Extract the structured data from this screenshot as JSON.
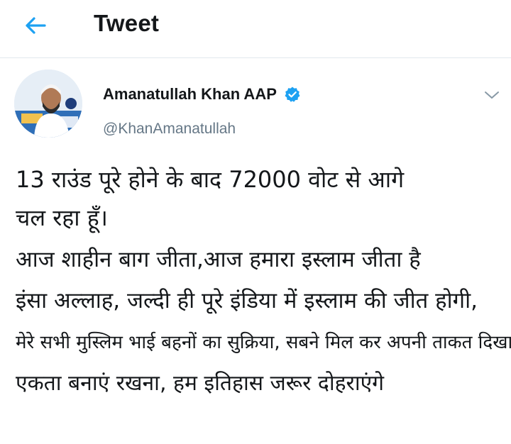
{
  "header": {
    "title": "Tweet",
    "back_icon": "arrow-left-icon"
  },
  "colors": {
    "accent": "#1da1f2",
    "text": "#14171a",
    "muted": "#657786",
    "divider": "#e1e8ed"
  },
  "author": {
    "display_name": "Amanatullah Khan AAP",
    "handle": "@KhanAmanatullah",
    "verified_icon": "verified-badge-icon",
    "avatar_icon": "profile-avatar",
    "menu_icon": "chevron-down-icon"
  },
  "tweet": {
    "lines": [
      "13 राउंड पूरे होने के बाद 72000 वोट से आगे",
      "चल रहा हूँ।",
      "आज शाहीन बाग जीता,आज हमारा इस्लाम जीता है",
      "इंसा अल्लाह, जल्दी ही पूरे इंडिया में इस्लाम की जीत होगी,",
      "मेरे सभी मुस्लिम भाई बहनों का सुक्रिया, सबने मिल कर अपनी ताकत दिखाई",
      "एकता बनाएं रखना, हम इतिहास जरूर दोहराएंगे"
    ]
  }
}
